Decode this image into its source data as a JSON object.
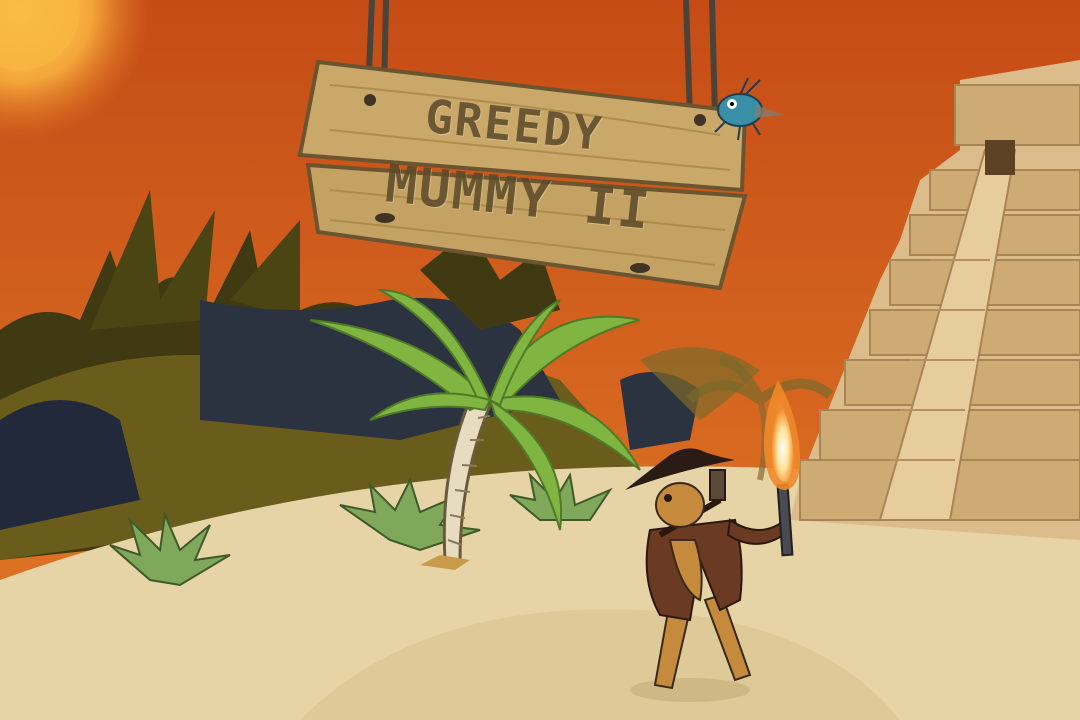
{
  "game": {
    "title_line1": "GREEDY",
    "title_line2": "MUMMY II"
  },
  "palette": {
    "sky_top": "#c84e17",
    "sky_bottom": "#e07124",
    "sun": "#f2b33a",
    "sand": "#e6d4a6",
    "sign_wood": "#c9a86a",
    "palm_leaf": "#7fb540",
    "temple_stone": "#dcbc8a"
  },
  "sprites": [
    "sun",
    "hanging-sign",
    "bug-creature",
    "palm-tree",
    "temple-pyramid",
    "explorer-character",
    "torch-flame"
  ]
}
